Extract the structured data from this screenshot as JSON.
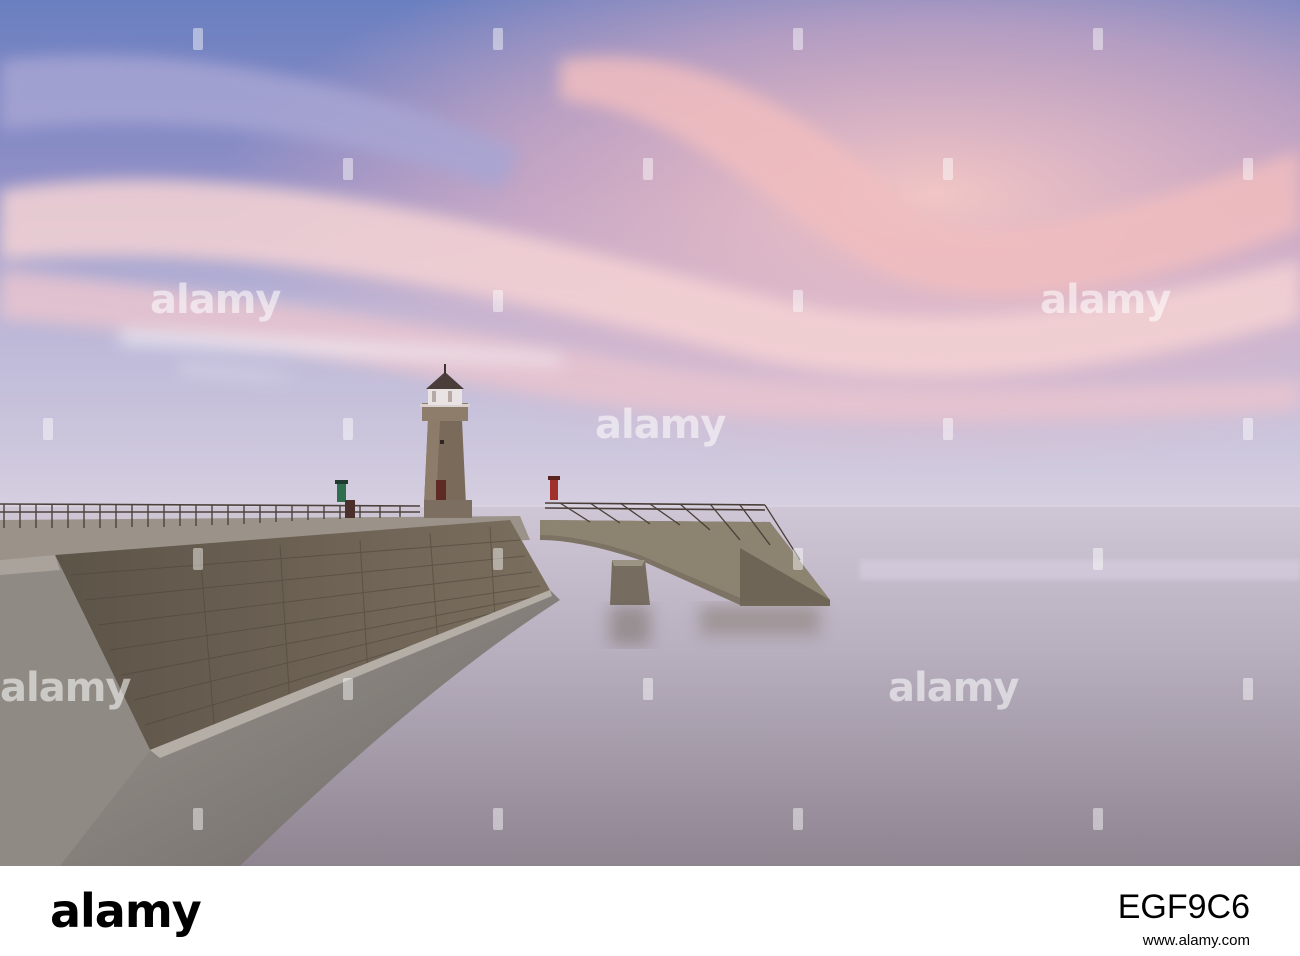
{
  "watermark": {
    "text": "alamy"
  },
  "footer": {
    "logo": "alamy",
    "image_id": "EGF9C6",
    "url": "www.alamy.com"
  },
  "photo": {
    "subject": "lighthouse-on-stone-pier-at-dusk",
    "colors": {
      "sky_top": "#6f86c4",
      "sky_pink": "#f2c2c6",
      "sea": "#b9b2c4",
      "stone": "#6c6152",
      "concrete": "#8c8780"
    }
  }
}
